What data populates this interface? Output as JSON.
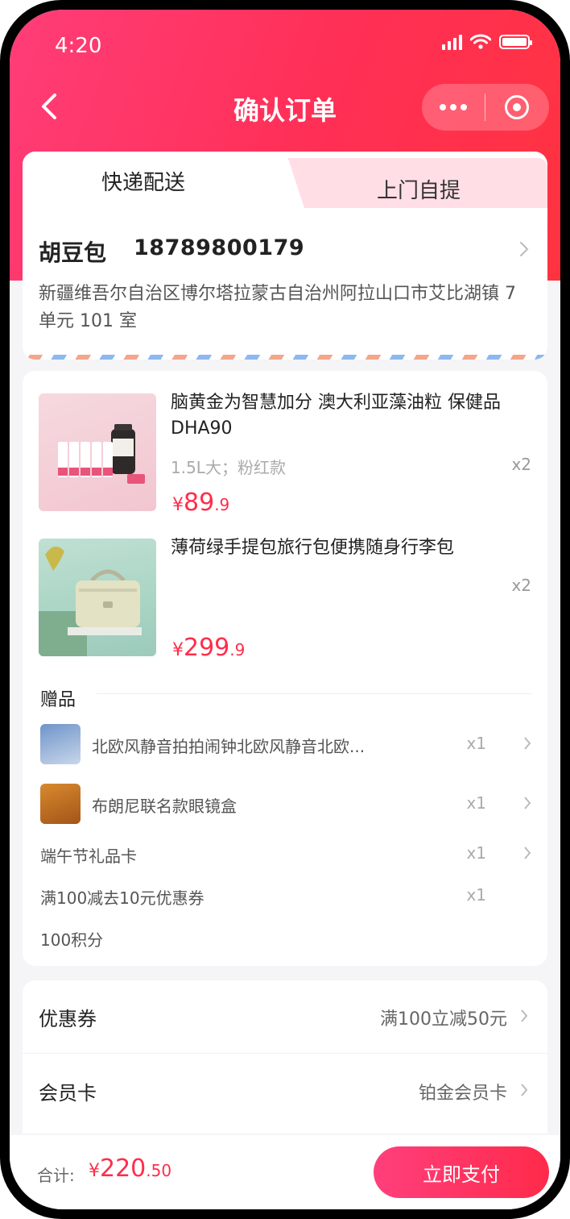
{
  "status_bar": {
    "time": "4:20"
  },
  "nav": {
    "title": "确认订单"
  },
  "delivery": {
    "tabs": [
      "快递配送",
      "上门自提"
    ],
    "active_tab": "快递配送",
    "name": "胡豆包",
    "phone": "18789800179",
    "address": "新疆维吾尔自治区博尔塔拉蒙古自治州阿拉山口市艾比湖镇 7 单元 101 室"
  },
  "products": [
    {
      "title": "脑黄金为智慧加分 澳大利亚藻油粒 保健品 DHA90",
      "spec": "1.5L大；粉红款",
      "qty": "x2",
      "price_symbol": "¥",
      "price_int": "89",
      "price_dec": ".9"
    },
    {
      "title": "薄荷绿手提包旅行包便携随身行李包",
      "spec": "",
      "qty": "x2",
      "price_symbol": "¥",
      "price_int": "299",
      "price_dec": ".9"
    }
  ],
  "gifts": {
    "heading": "赠品",
    "items": [
      {
        "label": "北欧风静音拍拍闹钟北欧风静音北欧...",
        "qty": "x1",
        "icon": "alarm-clock-thumbnail"
      },
      {
        "label": "布朗尼联名款眼镜盒",
        "qty": "x1",
        "icon": "glasses-case-thumbnail"
      },
      {
        "label": "端午节礼品卡",
        "qty": "x1"
      },
      {
        "label": "满100减去10元优惠券",
        "qty": "x1"
      },
      {
        "label": "100积分",
        "qty": ""
      }
    ]
  },
  "options": [
    {
      "label": "优惠券",
      "value": "满100立减50元"
    },
    {
      "label": "会员卡",
      "value": "铂金会员卡"
    }
  ],
  "footer": {
    "total_label": "合计:",
    "total_symbol": "¥",
    "total_int": "220",
    "total_dec": ".50",
    "pay_label": "立即支付"
  },
  "colors": {
    "accent": "#ff2d4b",
    "header_gradient_start": "#ff3d78",
    "header_gradient_end": "#ff3340",
    "tab_inactive": "#ffdfe5"
  }
}
